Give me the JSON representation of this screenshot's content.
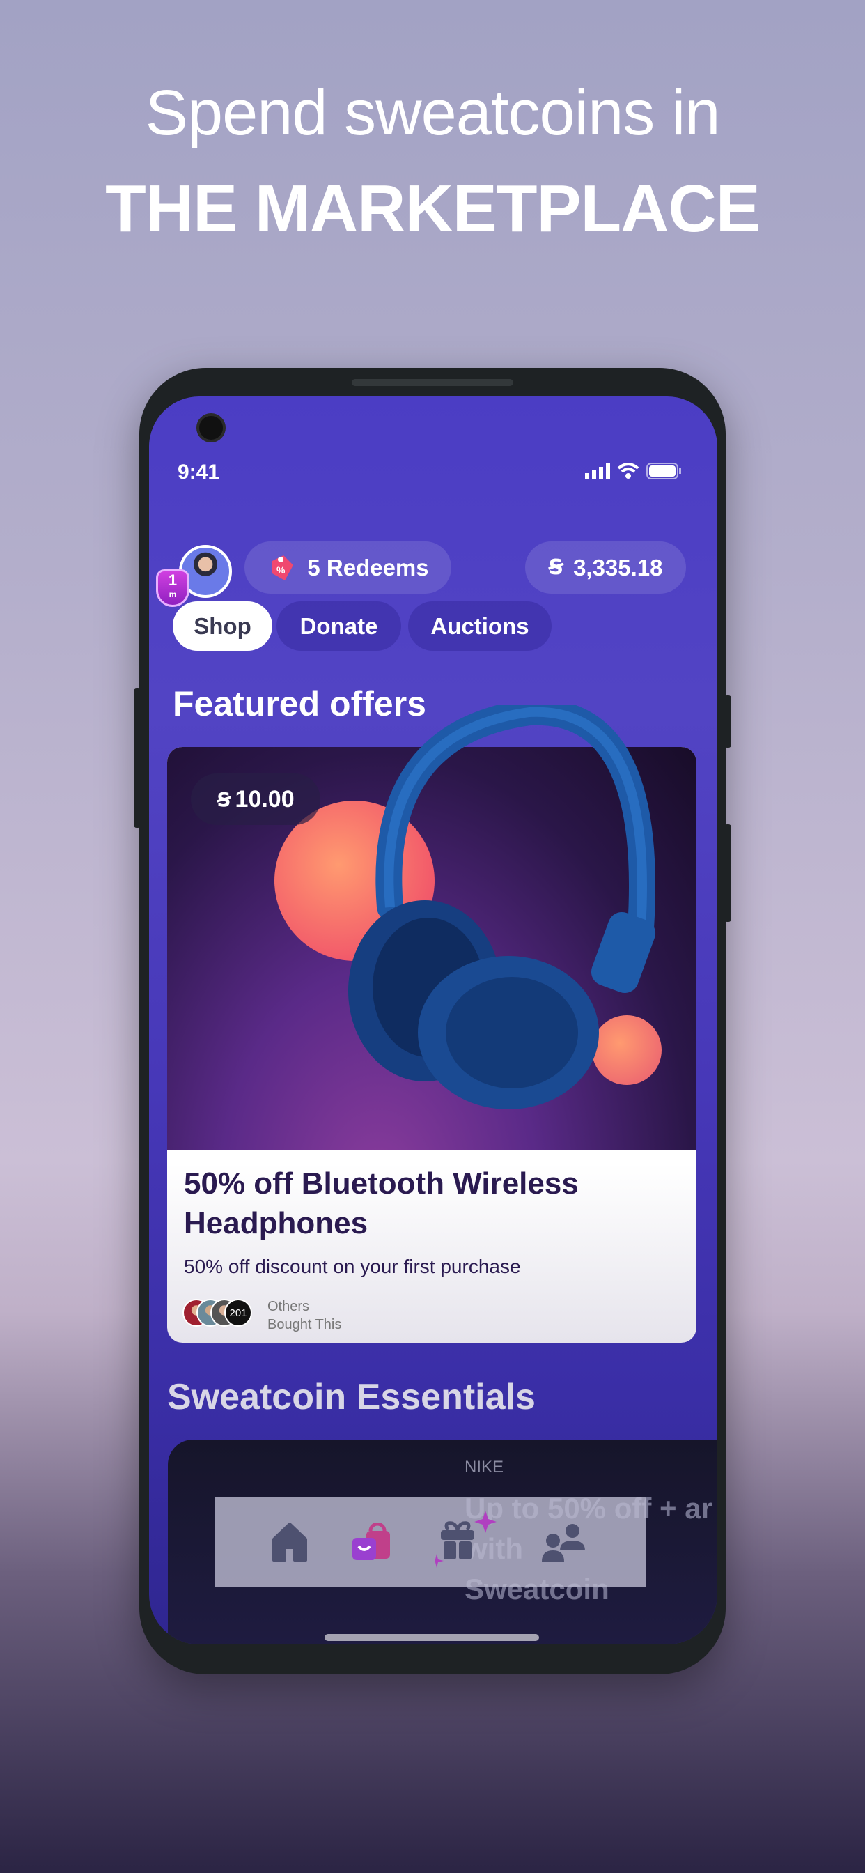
{
  "hero": {
    "line1": "Spend sweatcoins in",
    "line2": "THE MARKETPLACE"
  },
  "status_bar": {
    "time": "9:41"
  },
  "header": {
    "level_badge": {
      "number": "1",
      "unit": "m"
    },
    "redeems_label": "5 Redeems",
    "balance": "3,335.18"
  },
  "tabs": [
    {
      "label": "Shop",
      "active": true
    },
    {
      "label": "Donate",
      "active": false
    },
    {
      "label": "Auctions",
      "active": false
    }
  ],
  "featured": {
    "heading": "Featured offers",
    "offer": {
      "price": "10.00",
      "title": "50% off Bluetooth Wireless Headphones",
      "description": "50% off discount on your first purchase",
      "buyers_count": "201",
      "buyers_label_1": "Others",
      "buyers_label_2": "Bought This"
    }
  },
  "essentials": {
    "heading": "Sweatcoin Essentials",
    "card": {
      "brand": "NIKE",
      "title_line1": "Up to 50% off + ar",
      "title_line2": "with",
      "title_line3": "Sweatcoin"
    }
  },
  "bottom_nav": [
    {
      "icon": "home-icon"
    },
    {
      "icon": "shopping-bags-icon",
      "active": true
    },
    {
      "icon": "gift-icon"
    },
    {
      "icon": "people-icon"
    }
  ],
  "colors": {
    "accent": "#4b3dc4",
    "nav_active": "#b042c8",
    "title_text": "#2a1a50"
  }
}
